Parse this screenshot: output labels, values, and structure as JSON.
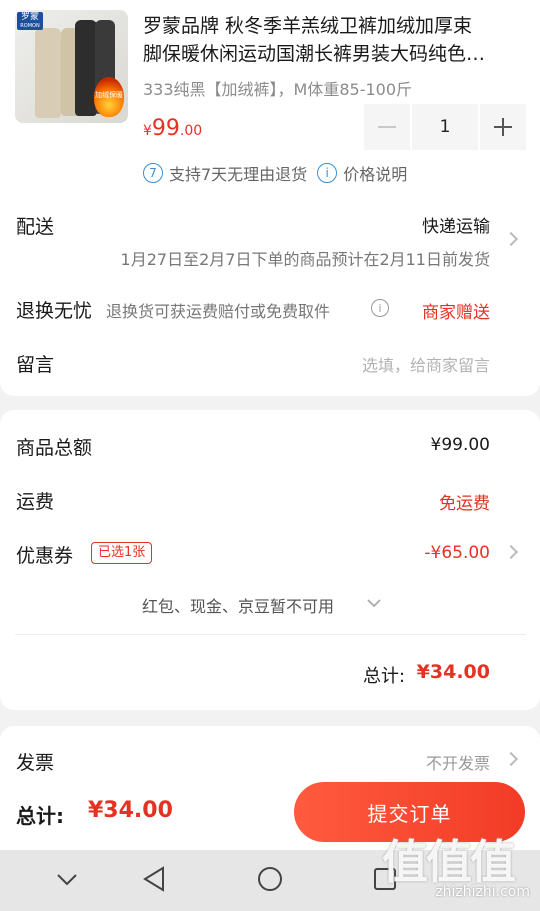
{
  "product": {
    "title_line1": "罗蒙品牌 秋冬季羊羔绒卫裤加绒加厚束",
    "title_line2": "脚保暖休闲运动国潮长裤男装大码纯色…",
    "spec": "333纯黑【加绒裤】，M体重85-100斤",
    "price_currency": "¥",
    "price_int": "99",
    "price_dec": ".00",
    "quantity": "1",
    "image_logo": "罗蒙",
    "image_logo_sub": "ROMON",
    "image_badge": "加绒保暖"
  },
  "support": {
    "return_badge": "7",
    "return_text": "支持7天无理由退货",
    "price_info_text": "价格说明"
  },
  "delivery": {
    "label": "配送",
    "method": "快递运输",
    "estimate": "1月27日至2月7日下单的商品预计在2月11日前发货"
  },
  "returns": {
    "label": "退换无忧",
    "desc": "退换货可获运费赔付或免费取件",
    "status": "商家赠送"
  },
  "message": {
    "label": "留言",
    "placeholder": "选填，给商家留言"
  },
  "summary": {
    "goods_total_label": "商品总额",
    "goods_total_value": "¥99.00",
    "shipping_label": "运费",
    "shipping_value": "免运费",
    "coupon_label": "优惠券",
    "coupon_tag": "已选1张",
    "coupon_value": "-¥65.00",
    "unavailable_text": "红包、现金、京豆暂不可用",
    "total_label": "总计:",
    "total_value": "¥34.00"
  },
  "invoice": {
    "label": "发票",
    "value": "不开发票"
  },
  "footer": {
    "total_label": "总计:",
    "total_value": "¥34.00",
    "submit_label": "提交订单"
  },
  "watermark": {
    "big": "值值值",
    "small": "zhizhizhi.com"
  },
  "colors": {
    "accent_red": "#e53222",
    "submit_gradient_start": "#ff5b3e",
    "submit_gradient_end": "#f23b26",
    "info_blue": "#3a8fd6"
  }
}
